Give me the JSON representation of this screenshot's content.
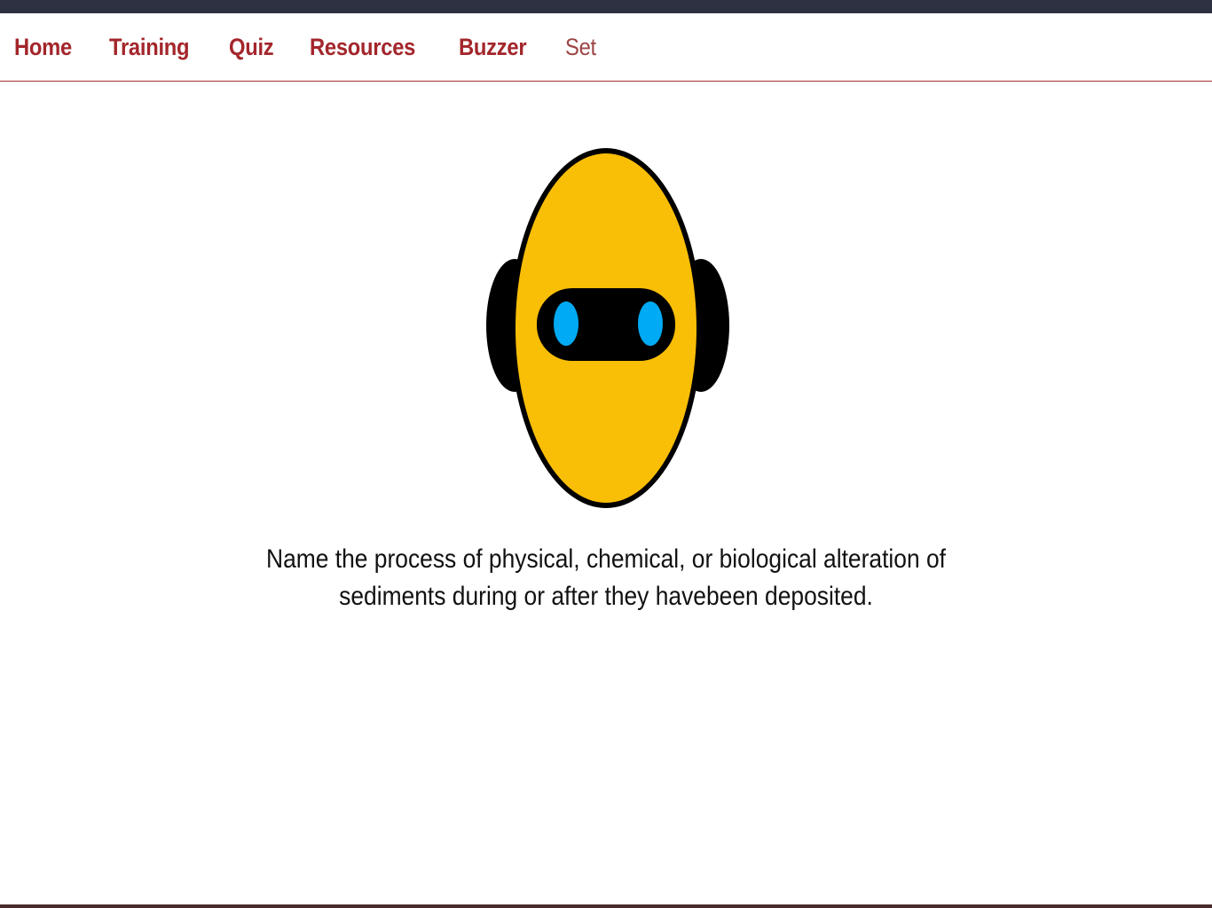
{
  "nav": {
    "items": [
      {
        "label": "Home"
      },
      {
        "label": "Training"
      },
      {
        "label": "Quiz"
      },
      {
        "label": "Resources"
      },
      {
        "label": "Buzzer"
      },
      {
        "label": "Set"
      }
    ]
  },
  "robot": {
    "icon": "robot-head-icon",
    "face_color": "#f9be06",
    "eye_color": "#00aaf4",
    "visor_color": "#000000"
  },
  "question": {
    "text": "Name the process of physical, chemical, or biological alteration of sediments during or after they havebeen deposited."
  },
  "colors": {
    "nav_accent": "#a3262b",
    "top_bar": "#2d3142"
  }
}
